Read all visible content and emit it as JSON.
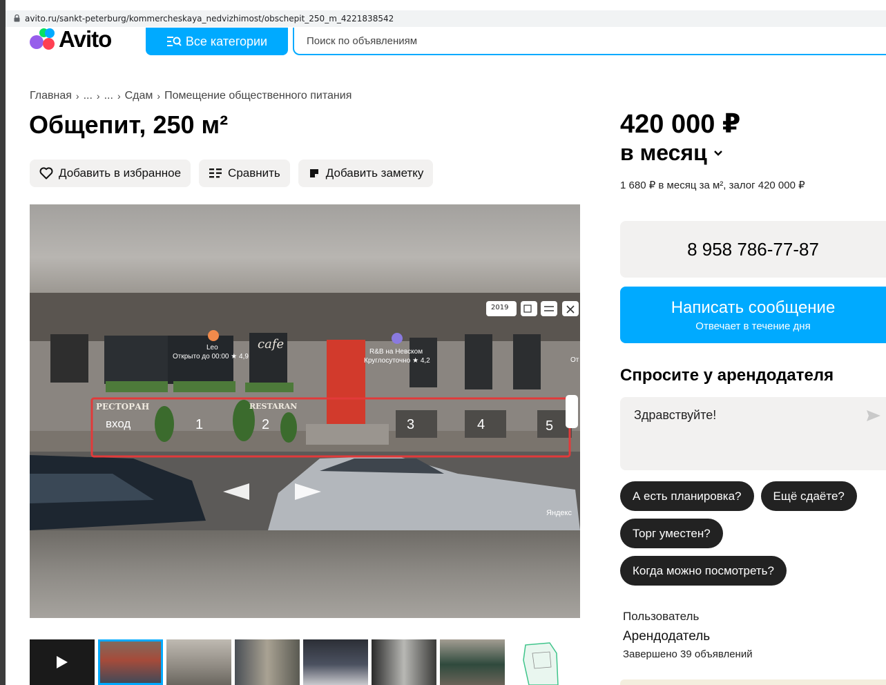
{
  "browser": {
    "url": "avito.ru/sankt-peterburg/kommercheskaya_nedvizhimost/obschepit_250_m_4221838542"
  },
  "header": {
    "logo_text": "Avito",
    "categories_label": "Все категории",
    "search_placeholder": "Поиск по объявлениям"
  },
  "breadcrumb": {
    "items": [
      "Главная",
      "...",
      "...",
      "Сдам",
      "Помещение общественного питания"
    ]
  },
  "listing": {
    "title": "Общепит, 250 м²",
    "actions": {
      "favorite": "Добавить в избранное",
      "compare": "Сравнить",
      "note": "Добавить заметку"
    }
  },
  "photo": {
    "overlay": {
      "year_select": "2019",
      "poi_1_name": "Leo",
      "poi_1_info": "Открыто до 00:00 ★ 4,9",
      "poi_2_name": "R&B на Невском",
      "poi_2_info": "Круглосуточно ★ 4,2",
      "sign_cafe": "cafe",
      "sign_restaurant": "РЕСТОРАН",
      "sign_restaran": "RESTARAN",
      "entrance": "вход",
      "numbers": [
        "1",
        "2",
        "3",
        "4",
        "5"
      ],
      "watermark": "Яндекс",
      "edge_text": "От"
    },
    "thumbnail_count": 8,
    "active_thumbnail": 2
  },
  "pricing": {
    "price": "420 000 ₽",
    "period": "в месяц",
    "details": "1 680 ₽ в месяц за м², залог 420 000 ₽"
  },
  "contact": {
    "phone": "8 958 786-77-87",
    "message_button": "Написать сообщение",
    "message_sub": "Отвечает в течение дня"
  },
  "ask": {
    "title": "Спросите у арендодателя",
    "input_value": "Здравствуйте!",
    "chips": [
      "А есть планировка?",
      "Ещё сдаёте?",
      "Торг уместен?",
      "Когда можно посмотреть?"
    ]
  },
  "seller": {
    "label": "Пользователь",
    "role": "Арендодатель",
    "stats": "Завершено 39 объявлений"
  },
  "colors": {
    "accent": "#00aaff",
    "chip_bg": "#222222",
    "button_bg": "#f2f1f0",
    "highlight_box": "#e23a3a"
  }
}
